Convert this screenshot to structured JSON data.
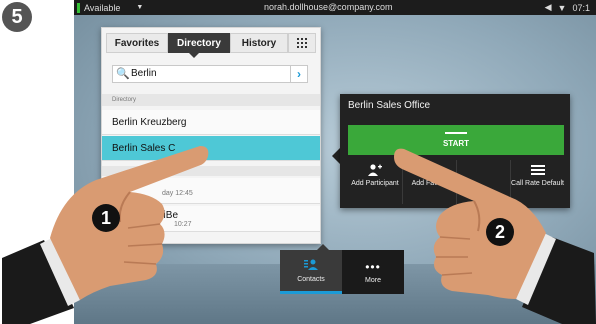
{
  "step_number": "5",
  "status_bar": {
    "availability": "Available",
    "email": "norah.dollhouse@company.com",
    "time": "07:1"
  },
  "tabs": {
    "favorites": "Favorites",
    "directory": "Directory",
    "history": "History"
  },
  "search": {
    "value": "Berlin"
  },
  "directory": {
    "section_label": "Directory",
    "items": [
      "Berlin Kreuzberg",
      "Berlin Sales C"
    ]
  },
  "history": {
    "item1_time": "day 12:45",
    "item2_name": "eiBe",
    "item2_time": "10:27"
  },
  "bottom_bar": {
    "contacts": "Contacts",
    "more": "More"
  },
  "contact_card": {
    "title": "Berlin Sales Office",
    "start_label": "START",
    "actions": [
      {
        "icon": "add-participant-icon",
        "label": "Add Participant"
      },
      {
        "icon": "add-favorite-icon",
        "label": "Add Favorit"
      },
      {
        "icon": "hidden-icon",
        "label": ""
      },
      {
        "icon": "call-rate-icon",
        "label": "Call Rate Default"
      }
    ]
  },
  "markers": [
    "1",
    "2"
  ],
  "colors": {
    "accent_blue": "#1b9ad6",
    "start_green": "#3aa83a",
    "selected_row": "#4ec8d6"
  }
}
